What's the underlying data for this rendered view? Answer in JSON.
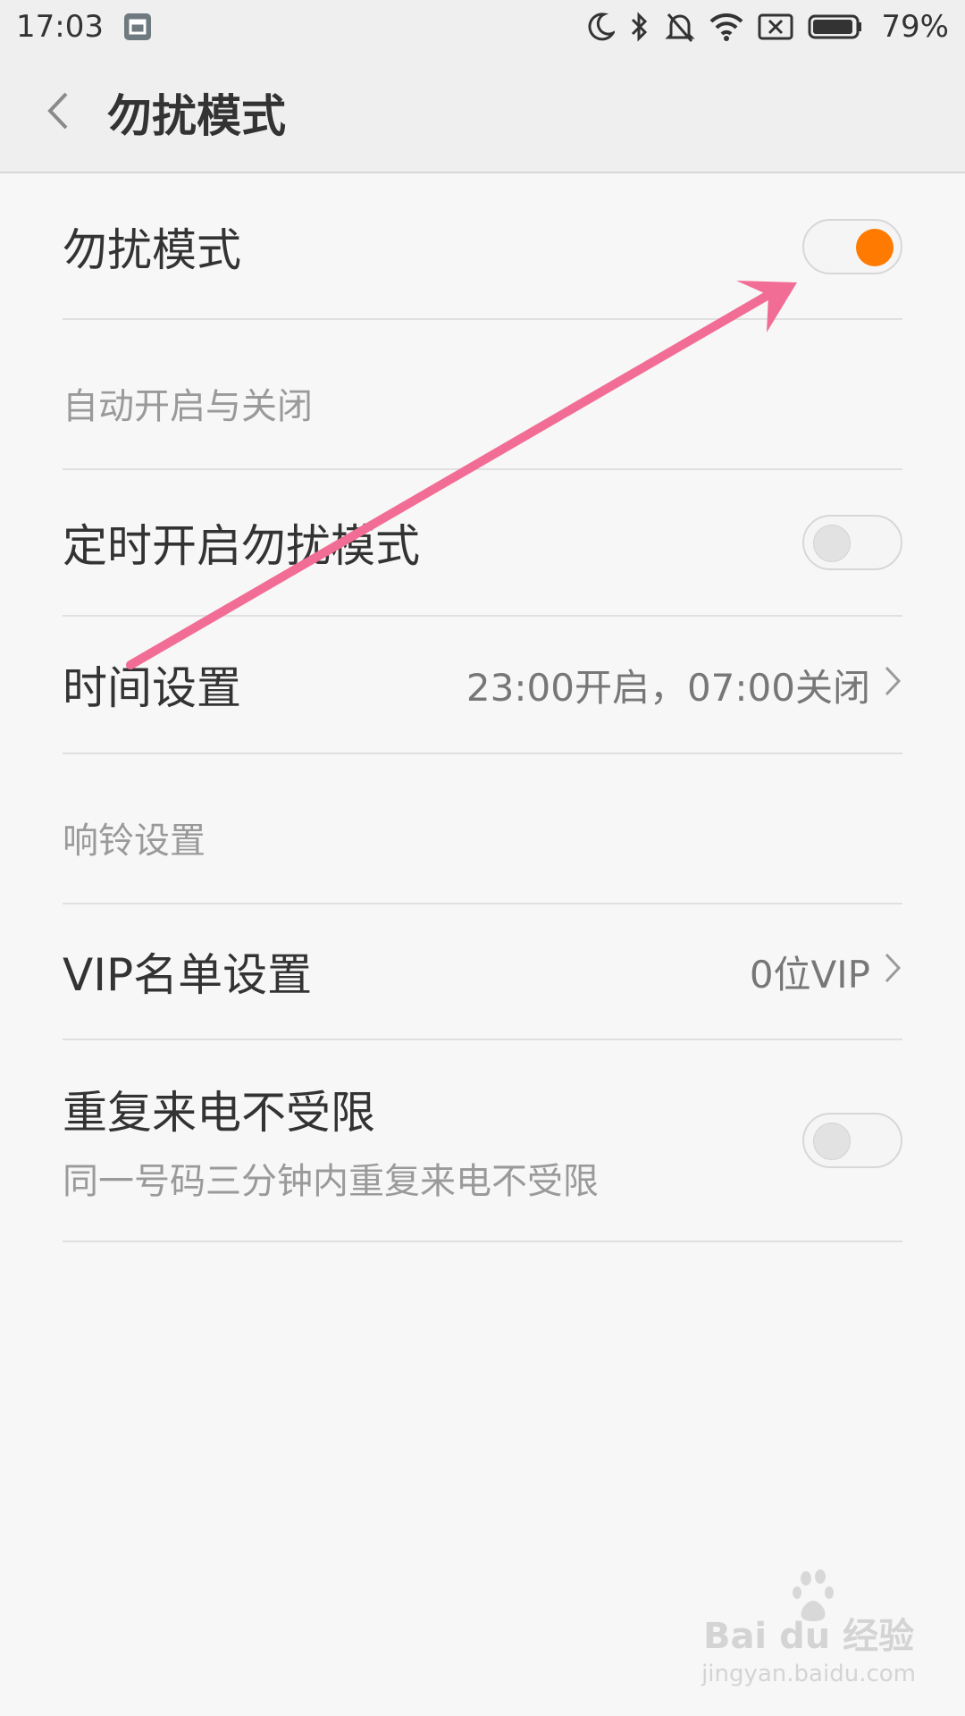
{
  "status_bar": {
    "time": "17:03",
    "battery_percent": "79%",
    "icons": [
      "app-notification-icon",
      "moon-icon",
      "bluetooth-icon",
      "bell-off-icon",
      "wifi-icon",
      "sim-x-icon",
      "battery-icon"
    ]
  },
  "header": {
    "title": "勿扰模式",
    "back_icon": "chevron-left-icon"
  },
  "settings": {
    "dnd": {
      "label": "勿扰模式",
      "enabled": true
    },
    "section_auto": "自动开启与关闭",
    "scheduled": {
      "label": "定时开启勿扰模式",
      "enabled": false
    },
    "time_settings": {
      "label": "时间设置",
      "value": "23:00开启，07:00关闭"
    },
    "section_ring": "响铃设置",
    "vip": {
      "label": "VIP名单设置",
      "value": "0位VIP"
    },
    "repeat_calls": {
      "label": "重复来电不受限",
      "description": "同一号码三分钟内重复来电不受限",
      "enabled": false
    }
  },
  "watermark": {
    "brand": "Bai du 经验",
    "url": "jingyan.baidu.com"
  },
  "colors": {
    "accent": "#ff7a00",
    "annotation_arrow": "#f26d96",
    "background": "#f7f7f7"
  }
}
